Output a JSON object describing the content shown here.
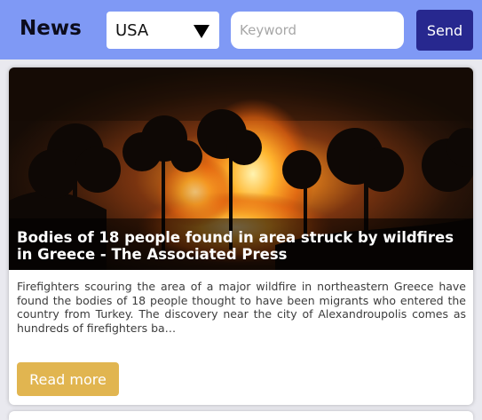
{
  "header": {
    "brand": "News",
    "country_select": {
      "value": "USA"
    },
    "search": {
      "placeholder": "Keyword",
      "value": ""
    },
    "send_label": "Send"
  },
  "article": {
    "image_icon": "wildfire-photo",
    "title": "Bodies of 18 people found in area struck by wildfires in Greece - The Associated Press",
    "description": "Firefighters scouring the area of a major wildfire in northeastern Greece have found the bodies of 18 people thought to have been migrants who entered the country from Turkey. The discovery near the city of Alexandroupolis comes as hundreds of firefighters ba…",
    "read_more_label": "Read more"
  },
  "colors": {
    "header_bg": "#7f99f5",
    "send_button": "#27288f",
    "read_more_button": "#e1b550",
    "page_bg": "#e9e9ef"
  }
}
